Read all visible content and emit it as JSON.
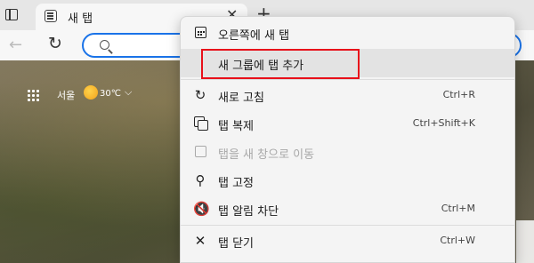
{
  "tab": {
    "title": "새 탭",
    "close_glyph": "✕",
    "icon": "new-tab-page-icon"
  },
  "newtab_glyph": "+",
  "toolbar": {
    "back_glyph": "←",
    "refresh_glyph": "↻"
  },
  "weather": {
    "city": "서울",
    "temp": "30℃",
    "chevron": "⌵"
  },
  "menu": {
    "items": [
      {
        "label": "오른쪽에 새 탭",
        "shortcut": "",
        "icon": "new-tab-right-icon",
        "disabled": false
      },
      {
        "label": "새 그룹에 탭 추가",
        "shortcut": "",
        "icon": "",
        "disabled": false
      },
      {
        "label": "새로 고침",
        "shortcut": "Ctrl+R",
        "icon": "refresh-icon",
        "disabled": false
      },
      {
        "label": "탭 복제",
        "shortcut": "Ctrl+Shift+K",
        "icon": "duplicate-icon",
        "disabled": false
      },
      {
        "label": "탭을 새 창으로 이동",
        "shortcut": "",
        "icon": "move-window-icon",
        "disabled": true
      },
      {
        "label": "탭 고정",
        "shortcut": "",
        "icon": "pin-icon",
        "disabled": false
      },
      {
        "label": "탭 알림 차단",
        "shortcut": "Ctrl+M",
        "icon": "mute-icon",
        "disabled": false
      },
      {
        "label": "탭 닫기",
        "shortcut": "Ctrl+W",
        "icon": "close-icon",
        "disabled": false
      }
    ],
    "highlight_color": "#e8101a"
  }
}
